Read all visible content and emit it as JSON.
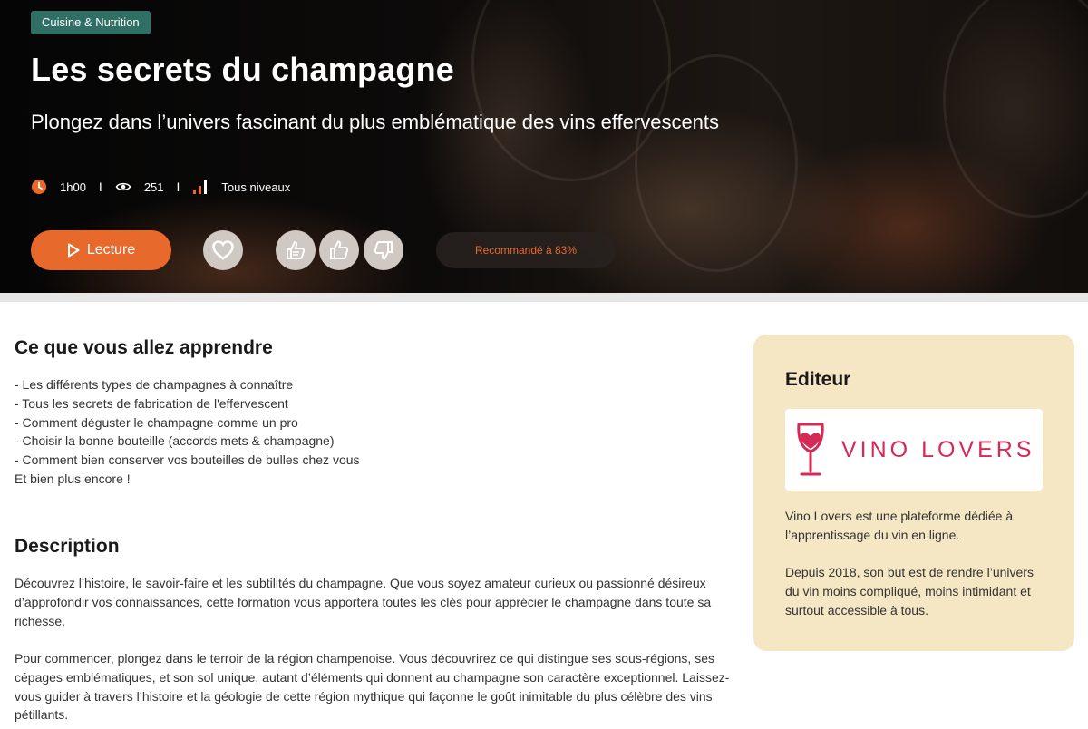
{
  "hero": {
    "category": "Cuisine & Nutrition",
    "title": "Les secrets du champagne",
    "subtitle": "Plongez dans l’univers fascinant du plus emblématique des vins effervescents",
    "meta": {
      "duration": "1h00",
      "views": "251",
      "level": "Tous niveaux",
      "separator": "I"
    },
    "play_label": "Lecture",
    "recommendation": "Recommandé à 83%",
    "accent_color": "#e8692c",
    "badge_color": "#2f6f64"
  },
  "main": {
    "learn_title": "Ce que vous allez apprendre",
    "learn_items": [
      "- Les différents types de champagnes à connaître",
      "- Tous les secrets de fabrication de l'effervescent",
      "- Comment déguster le champagne comme un pro",
      "- Choisir la bonne bouteille (accords mets & champagne)",
      "- Comment bien conserver vos bouteilles de bulles chez vous",
      "Et bien plus encore !"
    ],
    "description_title": "Description",
    "description_paragraphs": [
      "Découvrez l’histoire, le savoir-faire et les subtilités du champagne. Que vous soyez amateur curieux ou passionné désireux d’approfondir vos connaissances, cette formation vous apportera toutes les clés pour apprécier le champagne dans toute sa richesse.",
      "Pour commencer, plongez dans le terroir de la région champenoise. Vous découvrirez ce qui distingue ses sous-régions, ses cépages emblématiques, et son sol unique, autant d’éléments qui donnent au champagne son caractère exceptionnel. Laissez-vous guider à travers l’histoire et la géologie de cette région mythique qui façonne le goût inimitable du plus célèbre des vins pétillants."
    ]
  },
  "editor": {
    "title": "Editeur",
    "logo_text": "VINO LOVERS",
    "logo_color": "#d42a56",
    "card_color": "#f5e6c4",
    "paragraphs": [
      "Vino Lovers est une plateforme dédiée à l’apprentissage du vin en ligne.",
      "Depuis 2018, son but est de rendre l’univers du vin moins compliqué, moins intimidant et surtout accessible à tous."
    ]
  }
}
